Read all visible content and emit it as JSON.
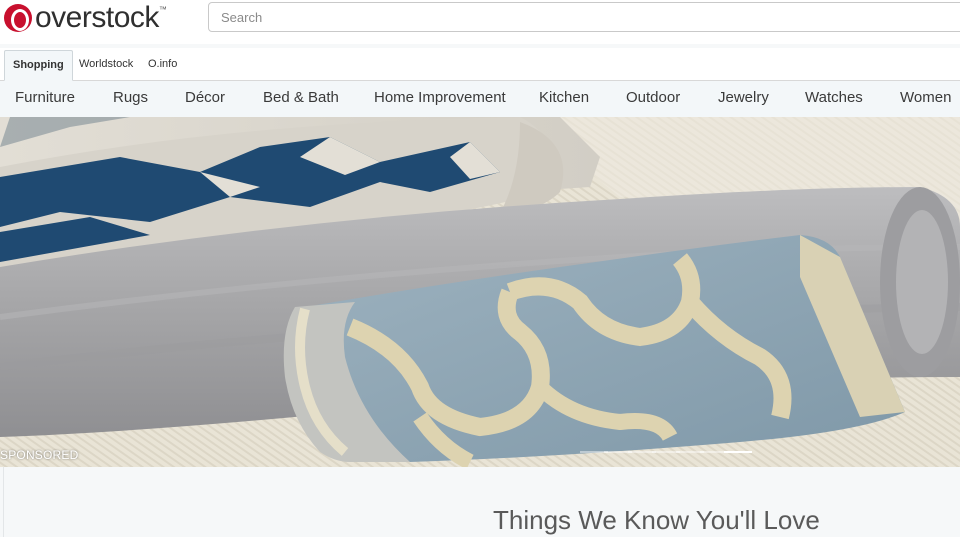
{
  "header": {
    "logo_text": "overstock",
    "logo_tm": "™",
    "search_placeholder": "Search"
  },
  "site_tabs": [
    {
      "label": "Shopping",
      "active": true
    },
    {
      "label": "Worldstock",
      "active": false
    },
    {
      "label": "O.info",
      "active": false
    }
  ],
  "categories": [
    "Furniture",
    "Rugs",
    "Décor",
    "Bed & Bath",
    "Home Improvement",
    "Kitchen",
    "Outdoor",
    "Jewelry",
    "Watches",
    "Women"
  ],
  "hero": {
    "sponsored_label": "SPONSORED",
    "slide_count": 7,
    "active_slide": 7
  },
  "main": {
    "section_title": "Things We Know You'll Love"
  },
  "colors": {
    "brand_red": "#c8102e",
    "nav_background": "#f3f7f9",
    "rug_navy": "#1f4a72",
    "rug_blue_gray": "#8fa6b4",
    "rug_gray": "#a9a9ab",
    "rug_cream": "#e7e1cf"
  }
}
